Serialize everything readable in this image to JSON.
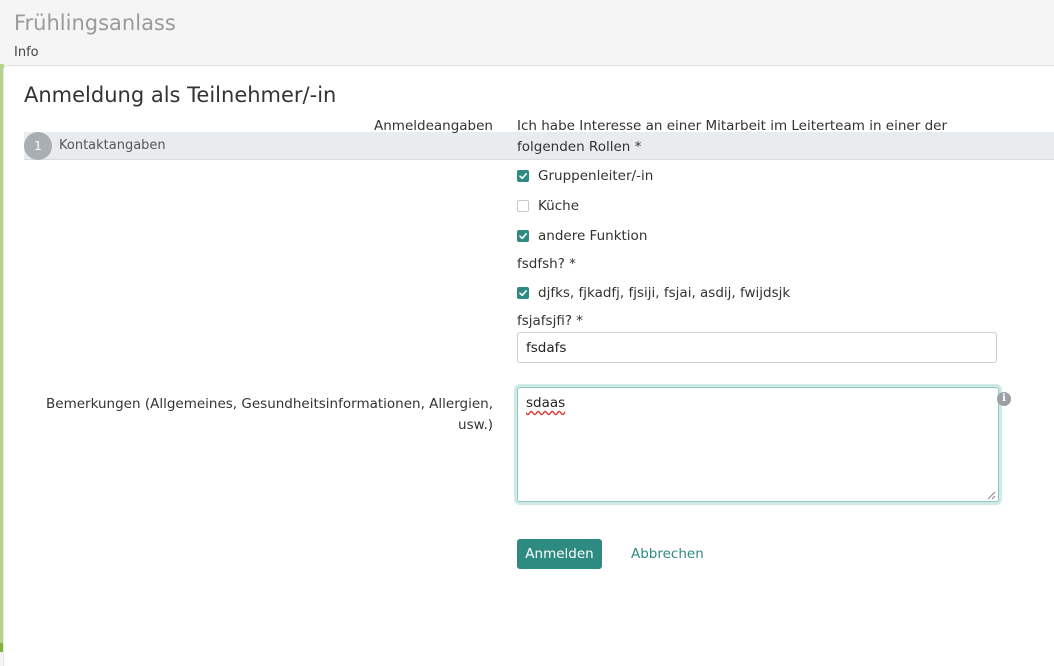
{
  "header": {
    "title": "Frühlingsanlass",
    "nav_info": "Info"
  },
  "form": {
    "title": "Anmeldung als Teilnehmer/-in",
    "step": {
      "number": "1",
      "label": "Kontaktangaben"
    },
    "section_label": "Anmeldeangaben",
    "question1": {
      "label": "Ich habe Interesse an einer Mitarbeit im Leiterteam in einer der",
      "label_cont": "folgenden Rollen *",
      "options": [
        {
          "label": "Gruppenleiter/-in",
          "checked": true
        },
        {
          "label": "Küche",
          "checked": false
        },
        {
          "label": "andere Funktion",
          "checked": true
        }
      ]
    },
    "question2": {
      "label": "fsdfsh? *",
      "options": [
        {
          "label": "djfks, fjkadfj, fjsiji, fsjai, asdij, fwijdsjk",
          "checked": true
        }
      ]
    },
    "question3": {
      "label": "fsjafsjfi? *",
      "value": "fsdafs"
    },
    "remarks": {
      "label_line1": "Bemerkungen (Allgemeines, Gesundheitsinformationen, Allergien,",
      "label_line2": "usw.)",
      "value": "sdaas",
      "info_icon": "info-icon"
    },
    "submit_label": "Anmelden",
    "cancel_label": "Abbrechen"
  },
  "colors": {
    "accent": "#2d8b82",
    "title_gray": "#9a9a9a",
    "step_bg": "#e9ecef",
    "left_edge": "#b5d38a"
  }
}
